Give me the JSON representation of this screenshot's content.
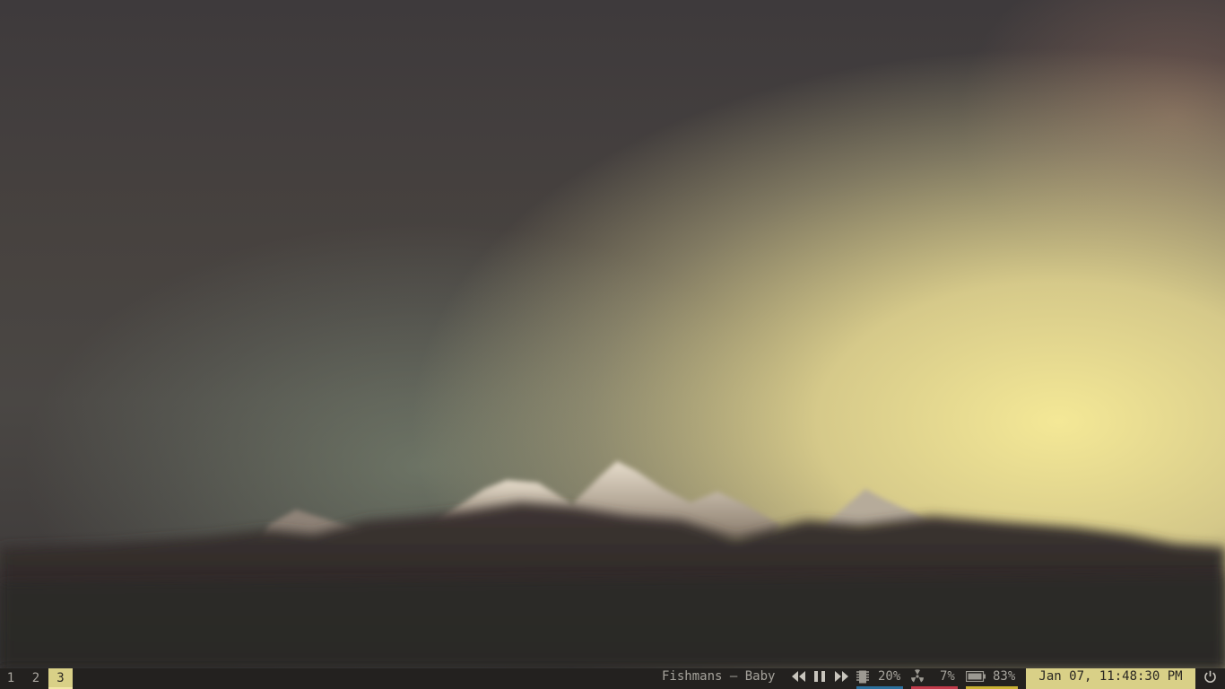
{
  "desktop": {
    "wallpaper": "mountain range at dusk with warm yellow sky"
  },
  "panel": {
    "workspaces": [
      {
        "label": "1",
        "active": false
      },
      {
        "label": "2",
        "active": false
      },
      {
        "label": "3",
        "active": true
      }
    ],
    "now_playing": "Fishmans – Baby",
    "media_controls": {
      "previous_icon": "rewind-icon",
      "pause_icon": "pause-icon",
      "next_icon": "fast-forward-icon"
    },
    "memory": {
      "icon": "memory-chip-icon",
      "value": "20%",
      "accent": "#2b6f9c"
    },
    "cpu": {
      "icon": "radioactive-icon",
      "value": "7%",
      "accent": "#c23a4a"
    },
    "battery": {
      "icon": "battery-icon",
      "value": "83%",
      "accent": "#c9b132"
    },
    "clock": "Jan 07, 11:48:30 PM",
    "power_icon": "power-icon",
    "colors": {
      "panel_bg": "#23211f",
      "highlight": "#d9d087",
      "text": "#a6a39c"
    }
  }
}
